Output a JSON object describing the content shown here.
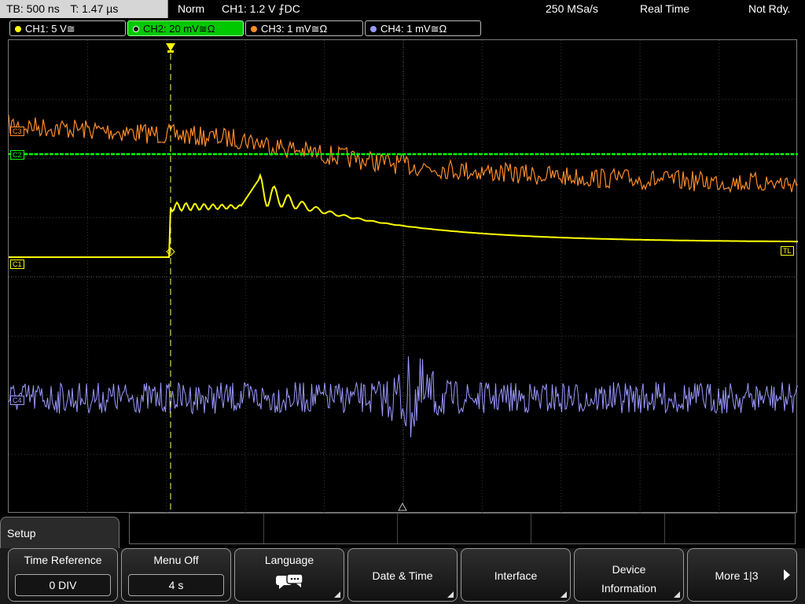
{
  "topbar": {
    "timebase": "TB: 500 ns",
    "trigger_time": "T: 1.47 µs",
    "mode": "Norm",
    "trigger": "CH1: 1.2 V ⨍DC",
    "sample_rate": "250 MSa/s",
    "acq_mode": "Real Time",
    "status": "Not Rdy."
  },
  "channels": [
    {
      "label": "CH1: 5 V≅",
      "color": "#ffff00"
    },
    {
      "label": "CH2: 20 mV≅Ω",
      "color": "#00ff00"
    },
    {
      "label": "CH3: 1 mV≅Ω",
      "color": "#ff8c28"
    },
    {
      "label": "CH4: 1 mV≅Ω",
      "color": "#9a98ff"
    }
  ],
  "markers": {
    "ch1": "C1",
    "ch2": "C2",
    "ch3": "C3",
    "ch4": "C4",
    "trigger_level": "TL"
  },
  "menu": {
    "title": "Setup",
    "time_reference": {
      "label": "Time Reference",
      "value": "0 DIV"
    },
    "menu_off": {
      "label": "Menu Off",
      "value": "4 s"
    },
    "language": {
      "label": "Language"
    },
    "date_time": {
      "label": "Date & Time"
    },
    "interface": {
      "label": "Interface"
    },
    "device_information": {
      "label": "Device Information"
    },
    "more": {
      "label": "More 1|3"
    }
  }
}
